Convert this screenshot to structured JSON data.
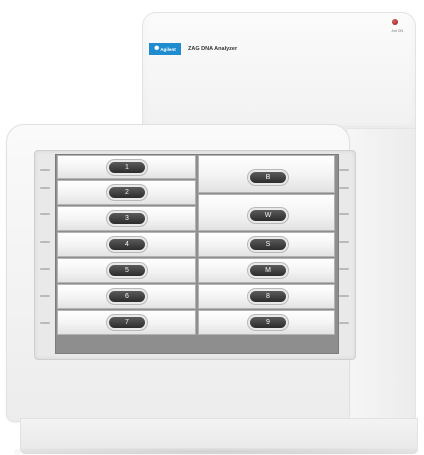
{
  "instrument": {
    "brand": "Agilent",
    "product_name": "ZAG DNA Analyzer",
    "status_label": "Ant ON",
    "brand_color": "#1e8ccf",
    "led_color": "#b22222"
  },
  "drawers_left": [
    {
      "label": "1"
    },
    {
      "label": "2"
    },
    {
      "label": "3"
    },
    {
      "label": "4"
    },
    {
      "label": "5"
    },
    {
      "label": "6"
    },
    {
      "label": "7"
    }
  ],
  "drawers_right": [
    {
      "label": "B"
    },
    {
      "label": "W"
    },
    {
      "label": "S"
    },
    {
      "label": "M"
    },
    {
      "label": "8"
    },
    {
      "label": "9"
    }
  ]
}
